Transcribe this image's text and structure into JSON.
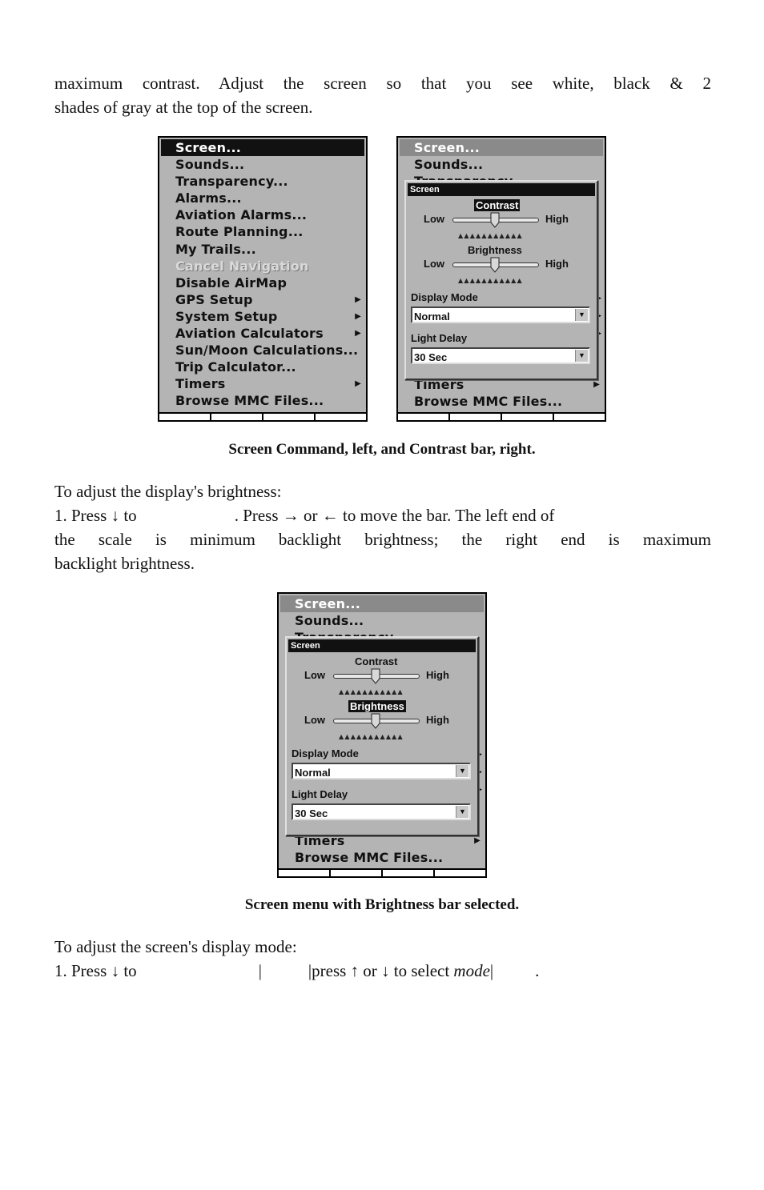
{
  "intro": {
    "line1": "maximum contrast. Adjust the screen so that you see white, black & 2",
    "line2": "shades of gray at the top of the screen."
  },
  "menu": {
    "items": [
      {
        "label": "Screen...",
        "submenu": false,
        "state": "selected"
      },
      {
        "label": "Sounds...",
        "submenu": false,
        "state": "normal"
      },
      {
        "label": "Transparency...",
        "submenu": false,
        "state": "normal"
      },
      {
        "label": "Alarms...",
        "submenu": false,
        "state": "normal"
      },
      {
        "label": "Aviation Alarms...",
        "submenu": false,
        "state": "normal"
      },
      {
        "label": "Route Planning...",
        "submenu": false,
        "state": "normal"
      },
      {
        "label": "My Trails...",
        "submenu": false,
        "state": "normal"
      },
      {
        "label": "Cancel Navigation",
        "submenu": false,
        "state": "disabled"
      },
      {
        "label": "Disable AirMap",
        "submenu": false,
        "state": "normal"
      },
      {
        "label": "GPS Setup",
        "submenu": true,
        "state": "normal"
      },
      {
        "label": "System Setup",
        "submenu": true,
        "state": "normal"
      },
      {
        "label": "Aviation Calculators",
        "submenu": true,
        "state": "normal"
      },
      {
        "label": "Sun/Moon Calculations...",
        "submenu": false,
        "state": "normal"
      },
      {
        "label": "Trip Calculator...",
        "submenu": false,
        "state": "normal"
      },
      {
        "label": "Timers",
        "submenu": true,
        "state": "normal"
      },
      {
        "label": "Browse MMC Files...",
        "submenu": false,
        "state": "normal"
      }
    ],
    "submenu_arrow": "▶"
  },
  "dialog": {
    "title": "Screen",
    "contrast_label": "Contrast",
    "brightness_label": "Brightness",
    "low_label": "Low",
    "high_label": "High",
    "contrast_value": 0.5,
    "brightness_value": 0.5,
    "ticks": "▲▲▲▲▲▲▲▲▲▲▲",
    "display_mode_label": "Display Mode",
    "display_mode_value": "Normal",
    "light_delay_label": "Light Delay",
    "light_delay_value": "30 Sec",
    "dropdown_arrow": "▼",
    "behind_items": {
      "screen": "Screen...",
      "sounds": "Sounds...",
      "timers": "Timers",
      "browse": "Browse MMC Files..."
    }
  },
  "caption1": "Screen Command, left, and Contrast bar, right.",
  "brightness_section": {
    "heading": "To adjust the display's brightness:",
    "step1_a": "1. Press ↓ to",
    "step1_b": ". Press → or ← to move the bar. The left end of",
    "line2": "the scale is minimum backlight brightness; the right end is maximum",
    "line3": "backlight brightness."
  },
  "caption2": "Screen menu with Brightness bar selected.",
  "display_mode_section": {
    "heading": "To adjust the screen's display mode:",
    "step1_a": "1. Press ↓ to",
    "sep": "|",
    "step1_b": "press ↑ or ↓ to select ",
    "step1_mode": "mode",
    "step1_end": "."
  }
}
